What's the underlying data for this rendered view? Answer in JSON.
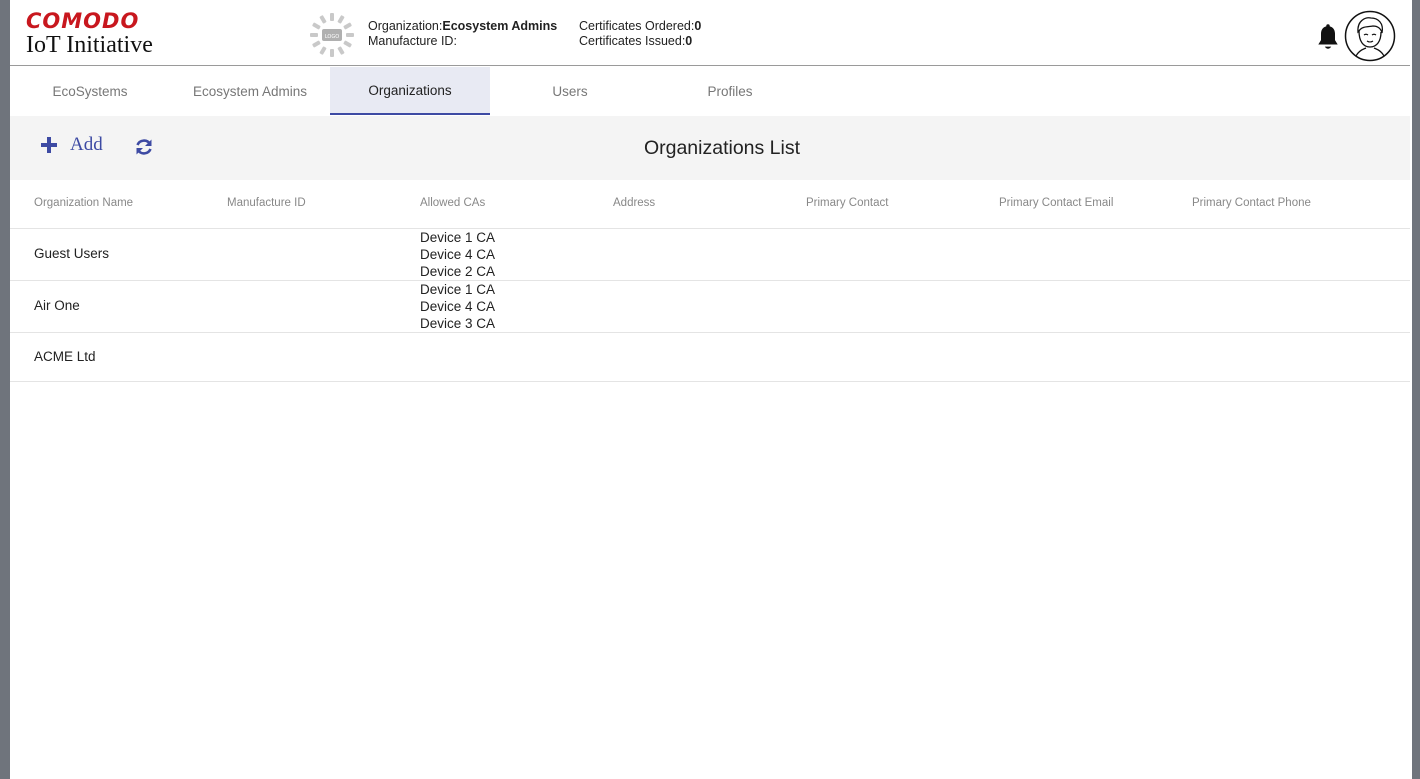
{
  "brand": {
    "company": "COMODO",
    "product": "IoT Initiative"
  },
  "header": {
    "org_label": "Organization:",
    "org_value": "Ecosystem Admins",
    "manufacture_label": "Manufacture ID:",
    "cert_ordered_label": "Certificates Ordered:",
    "cert_ordered_value": "0",
    "cert_issued_label": "Certificates Issued:",
    "cert_issued_value": "0",
    "logo_text": "LOGO",
    "icons": [
      "org-logo-placeholder",
      "bell-icon",
      "user-avatar-icon"
    ]
  },
  "tabs": [
    {
      "label": "EcoSystems",
      "active": false
    },
    {
      "label": "Ecosystem Admins",
      "active": false
    },
    {
      "label": "Organizations",
      "active": true
    },
    {
      "label": "Users",
      "active": false
    },
    {
      "label": "Profiles",
      "active": false
    }
  ],
  "toolbar": {
    "add_label": "Add",
    "title": "Organizations List",
    "icons": [
      "plus-icon",
      "refresh-icon"
    ]
  },
  "table": {
    "columns": [
      "Organization Name",
      "Manufacture ID",
      "Allowed CAs",
      "Address",
      "Primary Contact",
      "Primary Contact Email",
      "Primary Contact Phone"
    ],
    "rows": [
      {
        "name": "Guest Users",
        "cas": [
          "Device 1 CA",
          "Device 4 CA",
          "Device 2 CA"
        ]
      },
      {
        "name": "Air One",
        "cas": [
          "Device 1 CA",
          "Device 4 CA",
          "Device 3 CA"
        ]
      },
      {
        "name": "ACME Ltd",
        "cas": []
      }
    ]
  },
  "colors": {
    "brand_red": "#c8171e",
    "accent": "#3d4aa3",
    "active_tab_bg": "#e8eaf3",
    "toolbar_bg": "#f4f4f4"
  }
}
